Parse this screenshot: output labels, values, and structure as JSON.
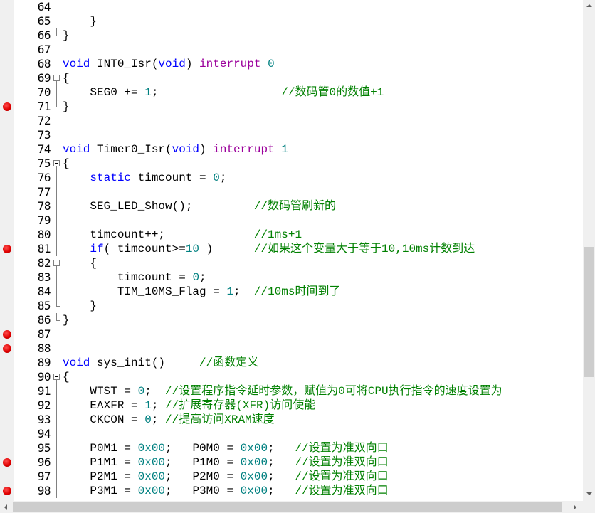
{
  "lines": [
    {
      "n": "64",
      "bp": false,
      "fold": "none",
      "tokens": []
    },
    {
      "n": "65",
      "bp": false,
      "fold": "none",
      "tokens": [
        {
          "c": "pl",
          "t": "    }"
        }
      ]
    },
    {
      "n": "66",
      "bp": false,
      "fold": "end",
      "tokens": [
        {
          "c": "pl",
          "t": "}"
        }
      ]
    },
    {
      "n": "67",
      "bp": false,
      "fold": "none",
      "tokens": []
    },
    {
      "n": "68",
      "bp": false,
      "fold": "none",
      "tokens": [
        {
          "c": "kw",
          "t": "void"
        },
        {
          "c": "pl",
          "t": " INT0_Isr("
        },
        {
          "c": "kw",
          "t": "void"
        },
        {
          "c": "pl",
          "t": ") "
        },
        {
          "c": "kw2",
          "t": "interrupt"
        },
        {
          "c": "pl",
          "t": " "
        },
        {
          "c": "num",
          "t": "0"
        }
      ]
    },
    {
      "n": "69",
      "bp": false,
      "fold": "start",
      "tokens": [
        {
          "c": "pl",
          "t": "{"
        }
      ]
    },
    {
      "n": "70",
      "bp": false,
      "fold": "mid",
      "tokens": [
        {
          "c": "pl",
          "t": "    SEG0 += "
        },
        {
          "c": "num",
          "t": "1"
        },
        {
          "c": "pl",
          "t": ";                  "
        },
        {
          "c": "cm",
          "t": "//数码管0的数值+1"
        }
      ]
    },
    {
      "n": "71",
      "bp": true,
      "fold": "end",
      "tokens": [
        {
          "c": "pl",
          "t": "}"
        }
      ]
    },
    {
      "n": "72",
      "bp": false,
      "fold": "none",
      "tokens": []
    },
    {
      "n": "73",
      "bp": false,
      "fold": "none",
      "tokens": []
    },
    {
      "n": "74",
      "bp": false,
      "fold": "none",
      "tokens": [
        {
          "c": "kw",
          "t": "void"
        },
        {
          "c": "pl",
          "t": " Timer0_Isr("
        },
        {
          "c": "kw",
          "t": "void"
        },
        {
          "c": "pl",
          "t": ") "
        },
        {
          "c": "kw2",
          "t": "interrupt"
        },
        {
          "c": "pl",
          "t": " "
        },
        {
          "c": "num",
          "t": "1"
        }
      ]
    },
    {
      "n": "75",
      "bp": false,
      "fold": "start",
      "tokens": [
        {
          "c": "pl",
          "t": "{"
        }
      ]
    },
    {
      "n": "76",
      "bp": false,
      "fold": "mid",
      "tokens": [
        {
          "c": "pl",
          "t": "    "
        },
        {
          "c": "kw",
          "t": "static"
        },
        {
          "c": "pl",
          "t": " timcount = "
        },
        {
          "c": "num",
          "t": "0"
        },
        {
          "c": "pl",
          "t": ";"
        }
      ]
    },
    {
      "n": "77",
      "bp": false,
      "fold": "mid",
      "tokens": []
    },
    {
      "n": "78",
      "bp": false,
      "fold": "mid",
      "tokens": [
        {
          "c": "pl",
          "t": "    SEG_LED_Show();         "
        },
        {
          "c": "cm",
          "t": "//数码管刷新的"
        }
      ]
    },
    {
      "n": "79",
      "bp": false,
      "fold": "mid",
      "tokens": []
    },
    {
      "n": "80",
      "bp": false,
      "fold": "mid",
      "tokens": [
        {
          "c": "pl",
          "t": "    timcount++;             "
        },
        {
          "c": "cm",
          "t": "//1ms+1"
        }
      ]
    },
    {
      "n": "81",
      "bp": true,
      "fold": "mid",
      "tokens": [
        {
          "c": "pl",
          "t": "    "
        },
        {
          "c": "kw",
          "t": "if"
        },
        {
          "c": "pl",
          "t": "( timcount>="
        },
        {
          "c": "num",
          "t": "10"
        },
        {
          "c": "pl",
          "t": " )      "
        },
        {
          "c": "cm",
          "t": "//如果这个变量大于等于10,10ms计数到达"
        }
      ]
    },
    {
      "n": "82",
      "bp": false,
      "fold": "start",
      "tokens": [
        {
          "c": "pl",
          "t": "    {"
        }
      ]
    },
    {
      "n": "83",
      "bp": false,
      "fold": "mid",
      "tokens": [
        {
          "c": "pl",
          "t": "        timcount = "
        },
        {
          "c": "num",
          "t": "0"
        },
        {
          "c": "pl",
          "t": ";"
        }
      ]
    },
    {
      "n": "84",
      "bp": false,
      "fold": "mid",
      "tokens": [
        {
          "c": "pl",
          "t": "        TIM_10MS_Flag = "
        },
        {
          "c": "num",
          "t": "1"
        },
        {
          "c": "pl",
          "t": ";  "
        },
        {
          "c": "cm",
          "t": "//10ms时间到了"
        }
      ]
    },
    {
      "n": "85",
      "bp": false,
      "fold": "end",
      "tokens": [
        {
          "c": "pl",
          "t": "    }"
        }
      ]
    },
    {
      "n": "86",
      "bp": false,
      "fold": "end",
      "tokens": [
        {
          "c": "pl",
          "t": "}"
        }
      ]
    },
    {
      "n": "87",
      "bp": true,
      "fold": "none",
      "tokens": []
    },
    {
      "n": "88",
      "bp": true,
      "fold": "none",
      "tokens": []
    },
    {
      "n": "89",
      "bp": false,
      "fold": "none",
      "tokens": [
        {
          "c": "kw",
          "t": "void"
        },
        {
          "c": "pl",
          "t": " sys_init()     "
        },
        {
          "c": "cm",
          "t": "//函数定义"
        }
      ]
    },
    {
      "n": "90",
      "bp": false,
      "fold": "start",
      "tokens": [
        {
          "c": "pl",
          "t": "{"
        }
      ]
    },
    {
      "n": "91",
      "bp": false,
      "fold": "mid",
      "tokens": [
        {
          "c": "pl",
          "t": "    WTST = "
        },
        {
          "c": "num",
          "t": "0"
        },
        {
          "c": "pl",
          "t": ";  "
        },
        {
          "c": "cm",
          "t": "//设置程序指令延时参数，赋值为0可将CPU执行指令的速度设置为"
        }
      ]
    },
    {
      "n": "92",
      "bp": false,
      "fold": "mid",
      "tokens": [
        {
          "c": "pl",
          "t": "    EAXFR = "
        },
        {
          "c": "num",
          "t": "1"
        },
        {
          "c": "pl",
          "t": "; "
        },
        {
          "c": "cm",
          "t": "//扩展寄存器(XFR)访问使能"
        }
      ]
    },
    {
      "n": "93",
      "bp": false,
      "fold": "mid",
      "tokens": [
        {
          "c": "pl",
          "t": "    CKCON = "
        },
        {
          "c": "num",
          "t": "0"
        },
        {
          "c": "pl",
          "t": "; "
        },
        {
          "c": "cm",
          "t": "//提高访问XRAM速度"
        }
      ]
    },
    {
      "n": "94",
      "bp": false,
      "fold": "mid",
      "tokens": []
    },
    {
      "n": "95",
      "bp": false,
      "fold": "mid",
      "tokens": [
        {
          "c": "pl",
          "t": "    P0M1 = "
        },
        {
          "c": "num",
          "t": "0x00"
        },
        {
          "c": "pl",
          "t": ";   P0M0 = "
        },
        {
          "c": "num",
          "t": "0x00"
        },
        {
          "c": "pl",
          "t": ";   "
        },
        {
          "c": "cm",
          "t": "//设置为准双向口"
        }
      ]
    },
    {
      "n": "96",
      "bp": true,
      "fold": "mid",
      "tokens": [
        {
          "c": "pl",
          "t": "    P1M1 = "
        },
        {
          "c": "num",
          "t": "0x00"
        },
        {
          "c": "pl",
          "t": ";   P1M0 = "
        },
        {
          "c": "num",
          "t": "0x00"
        },
        {
          "c": "pl",
          "t": ";   "
        },
        {
          "c": "cm",
          "t": "//设置为准双向口"
        }
      ]
    },
    {
      "n": "97",
      "bp": false,
      "fold": "mid",
      "tokens": [
        {
          "c": "pl",
          "t": "    P2M1 = "
        },
        {
          "c": "num",
          "t": "0x00"
        },
        {
          "c": "pl",
          "t": ";   P2M0 = "
        },
        {
          "c": "num",
          "t": "0x00"
        },
        {
          "c": "pl",
          "t": ";   "
        },
        {
          "c": "cm",
          "t": "//设置为准双向口"
        }
      ]
    },
    {
      "n": "98",
      "bp": true,
      "fold": "mid",
      "tokens": [
        {
          "c": "pl",
          "t": "    P3M1 = "
        },
        {
          "c": "num",
          "t": "0x00"
        },
        {
          "c": "pl",
          "t": ";   P3M0 = "
        },
        {
          "c": "num",
          "t": "0x00"
        },
        {
          "c": "pl",
          "t": ";   "
        },
        {
          "c": "cm",
          "t": "//设置为准双向口"
        }
      ]
    }
  ],
  "colors": {
    "keyword": "#0000ff",
    "interrupt_keyword": "#9b009b",
    "number": "#008080",
    "comment": "#008000",
    "breakpoint": "#e00000"
  },
  "icons": {
    "breakpoint": "breakpoint-icon",
    "fold": "fold-minus-icon"
  }
}
